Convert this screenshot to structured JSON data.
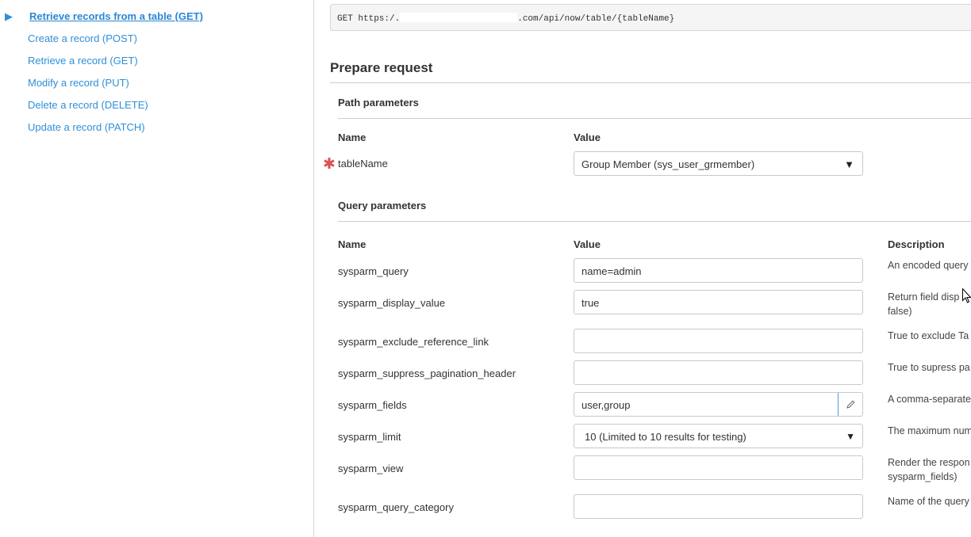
{
  "sidebar": {
    "items": [
      {
        "label": "Retrieve records from a table  (GET)",
        "active": true
      },
      {
        "label": "Create a record  (POST)"
      },
      {
        "label": "Retrieve a record  (GET)"
      },
      {
        "label": "Modify a record  (PUT)"
      },
      {
        "label": "Delete a record  (DELETE)"
      },
      {
        "label": "Update a record  (PATCH)"
      }
    ]
  },
  "endpoint": {
    "prefix": "GET https:/.",
    "suffix": ".com/api/now/table/{tableName}"
  },
  "prepare": {
    "title": "Prepare request",
    "path_params": {
      "title": "Path parameters",
      "col_name": "Name",
      "col_value": "Value",
      "rows": [
        {
          "name": "tableName",
          "required": true,
          "value": "Group Member (sys_user_grmember)"
        }
      ]
    },
    "query_params": {
      "title": "Query parameters",
      "col_name": "Name",
      "col_value": "Value",
      "col_desc": "Description",
      "rows": [
        {
          "name": "sysparm_query",
          "value": "name=admin",
          "desc": "An encoded query"
        },
        {
          "name": "sysparm_display_value",
          "value": "true",
          "desc": "Return field disp",
          "desc2": "false)"
        },
        {
          "name": "sysparm_exclude_reference_link",
          "value": "",
          "desc": "True to exclude Ta"
        },
        {
          "name": "sysparm_suppress_pagination_header",
          "value": "",
          "desc": "True to supress pa"
        },
        {
          "name": "sysparm_fields",
          "value": "user,group",
          "desc": "A comma-separate"
        },
        {
          "name": "sysparm_limit",
          "value": "10 (Limited to 10 results for testing)",
          "desc": "The maximum num"
        },
        {
          "name": "sysparm_view",
          "value": "",
          "desc": "Render the respon",
          "desc2": "sysparm_fields)"
        },
        {
          "name": "sysparm_query_category",
          "value": "",
          "desc": "Name of the query"
        }
      ]
    }
  },
  "icons": {
    "nav_arrow": "play-triangle-icon",
    "required": "asterisk-icon",
    "edit": "pencil-icon",
    "cursor": "mouse-pointer-icon"
  },
  "colors": {
    "link": "#2f8fd8",
    "required": "#d9534f",
    "focus_border": "#5b9bd5"
  }
}
